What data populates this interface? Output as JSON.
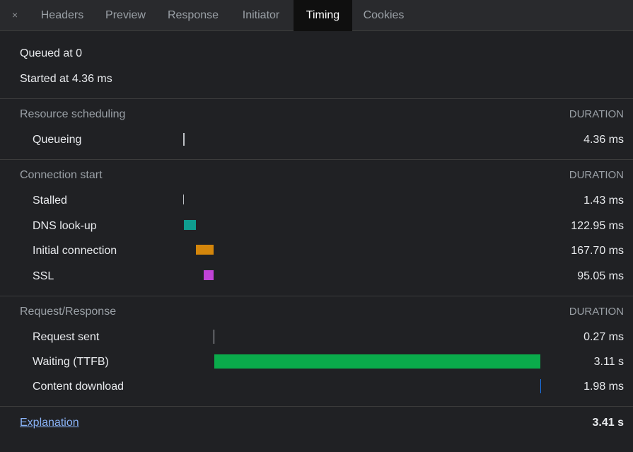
{
  "tabs": {
    "close_glyph": "×",
    "items": [
      "Headers",
      "Preview",
      "Response",
      "Initiator",
      "Timing",
      "Cookies"
    ],
    "active": "Timing"
  },
  "summary": {
    "queued": "Queued at 0",
    "started": "Started at 4.36 ms"
  },
  "sections": [
    {
      "title": "Resource scheduling",
      "duration_header": "DURATION",
      "rows": [
        {
          "label": "Queueing",
          "value": "4.36 ms",
          "color": "#bdc1c6",
          "kind": "tick",
          "start_ms": 0,
          "duration_ms": 4.36
        }
      ]
    },
    {
      "title": "Connection start",
      "duration_header": "DURATION",
      "rows": [
        {
          "label": "Stalled",
          "value": "1.43 ms",
          "color": "#bdc1c6",
          "kind": "tick",
          "start_ms": 4.36,
          "duration_ms": 1.43
        },
        {
          "label": "DNS look-up",
          "value": "122.95 ms",
          "color": "#0f9d8f",
          "kind": "bar",
          "start_ms": 5.79,
          "duration_ms": 122.95
        },
        {
          "label": "Initial connection",
          "value": "167.70 ms",
          "color": "#d4860b",
          "kind": "bar",
          "start_ms": 128.74,
          "duration_ms": 167.7
        },
        {
          "label": "SSL",
          "value": "95.05 ms",
          "color": "#c043d6",
          "kind": "bar",
          "start_ms": 201.39,
          "duration_ms": 95.05
        }
      ]
    },
    {
      "title": "Request/Response",
      "duration_header": "DURATION",
      "rows": [
        {
          "label": "Request sent",
          "value": "0.27 ms",
          "color": "#bdc1c6",
          "kind": "tick",
          "start_ms": 296.44,
          "duration_ms": 0.27
        },
        {
          "label": "Waiting (TTFB)",
          "value": "3.11 s",
          "color": "#0aab4b",
          "kind": "bar",
          "start_ms": 296.71,
          "duration_ms": 3110
        },
        {
          "label": "Content download",
          "value": "1.98 ms",
          "color": "#1a73e8",
          "kind": "tick",
          "start_ms": 3406.71,
          "duration_ms": 1.98
        }
      ]
    }
  ],
  "footer": {
    "explanation": "Explanation",
    "total": "3.41 s"
  },
  "colors": {
    "background": "#202124",
    "tabbar": "#292a2d",
    "active_tab": "#0f0f0f",
    "link": "#8ab4f8"
  }
}
